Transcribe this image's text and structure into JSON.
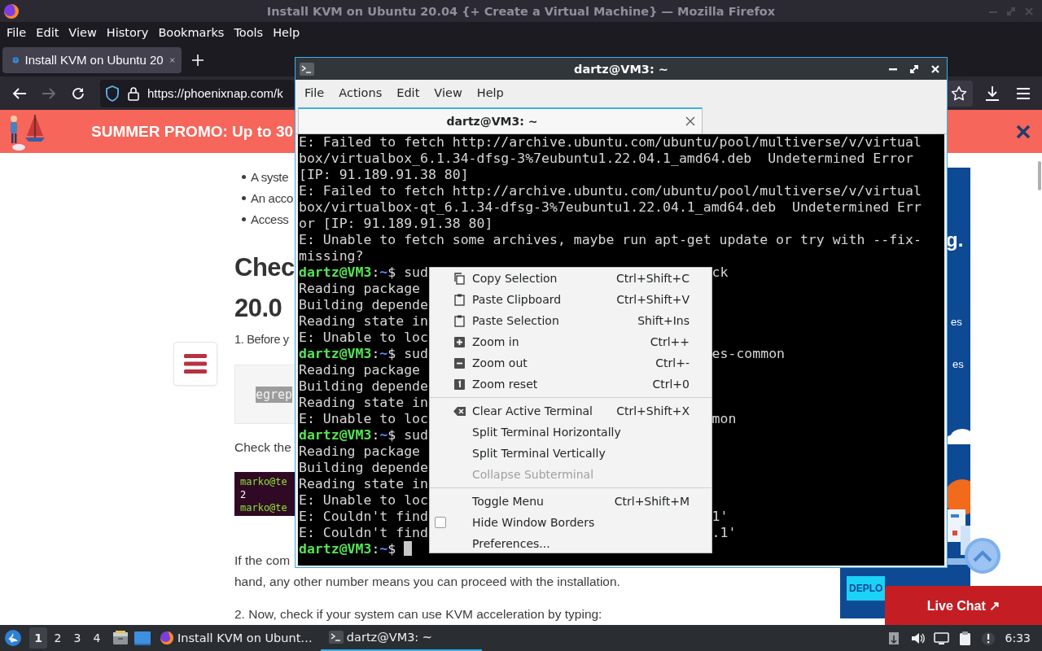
{
  "firefox": {
    "title": "Install KVM on Ubuntu 20.04 {+ Create a Virtual Machine} — Mozilla Firefox",
    "menu": [
      "File",
      "Edit",
      "View",
      "History",
      "Bookmarks",
      "Tools",
      "Help"
    ],
    "tabs": [
      {
        "label": "Install KVM on Ubuntu 20",
        "selected": true
      }
    ],
    "forward_disabled": true,
    "url": "https://phoenixnap.com/k",
    "promo": {
      "text": "SUMMER PROMO: Up to 30"
    },
    "article": {
      "bullets": [
        "A syste",
        "An acco",
        "Access"
      ],
      "heading_lines": [
        "Chec",
        "20.0"
      ],
      "step_1": "1. Before y",
      "code": "egrep",
      "check_text": "Check the",
      "output_lines": [
        {
          "kind": "prompt",
          "text": "marko@te"
        },
        {
          "kind": "output",
          "text": "2"
        },
        {
          "kind": "prompt",
          "text": "marko@te"
        }
      ],
      "paragraph_lines": [
        "If the com",
        "hand, any other number means you can proceed with the installation."
      ],
      "step_2": "2. Now, check if your system can use KVM acceleration by typing:"
    },
    "ad": {
      "fragments": [
        "g.",
        "es",
        "es"
      ],
      "button": "DEPLO"
    },
    "live_chat": "Live Chat ↗"
  },
  "terminal": {
    "title": "dartz@VM3: ~",
    "menu": [
      "File",
      "Actions",
      "Edit",
      "View",
      "Help"
    ],
    "tabs": [
      {
        "label": "dartz@VM3: ~",
        "selected": true
      }
    ],
    "lines": [
      {
        "kind": "output",
        "text": "E: Failed to fetch http://archive.ubuntu.com/ubuntu/pool/multiverse/v/virtual"
      },
      {
        "kind": "output",
        "text": "box/virtualbox_6.1.34-dfsg-3%7eubuntu1.22.04.1_amd64.deb  Undetermined Error"
      },
      {
        "kind": "output",
        "text": "[IP: 91.189.91.38 80]"
      },
      {
        "kind": "output",
        "text": "E: Failed to fetch http://archive.ubuntu.com/ubuntu/pool/multiverse/v/virtual"
      },
      {
        "kind": "output",
        "text": "box/virtualbox-qt_6.1.34-dfsg-3%7eubuntu1.22.04.1_amd64.deb  Undetermined Err"
      },
      {
        "kind": "output",
        "text": "or [IP: 91.189.91.38 80]"
      },
      {
        "kind": "output",
        "text": "E: Unable to fetch some archives, maybe run apt-get update or try with --fix-"
      },
      {
        "kind": "output",
        "text": "missing?"
      },
      {
        "kind": "prompt",
        "user": "dartz@VM3",
        "sep": ":",
        "path": "~",
        "sigil": "$",
        "command": "sud",
        "tail": "ck"
      },
      {
        "kind": "output",
        "text": "Reading package"
      },
      {
        "kind": "output",
        "text": "Building depende"
      },
      {
        "kind": "output",
        "text": "Reading state in"
      },
      {
        "kind": "output",
        "text": "E: Unable to loc"
      },
      {
        "kind": "prompt",
        "user": "dartz@VM3",
        "sep": ":",
        "path": "~",
        "sigil": "$",
        "command": "sud",
        "tail": "es-common"
      },
      {
        "kind": "output",
        "text": "Reading package"
      },
      {
        "kind": "output",
        "text": "Building depende"
      },
      {
        "kind": "output",
        "text": "Reading state in"
      },
      {
        "kind": "output",
        "text": "E: Unable to loc",
        "tail": "mon"
      },
      {
        "kind": "prompt",
        "user": "dartz@VM3",
        "sep": ":",
        "path": "~",
        "sigil": "$",
        "command": "sud"
      },
      {
        "kind": "output",
        "text": "Reading package"
      },
      {
        "kind": "output",
        "text": "Building depende"
      },
      {
        "kind": "output",
        "text": "Reading state in"
      },
      {
        "kind": "output",
        "text": "E: Unable to loc"
      },
      {
        "kind": "output",
        "text": "E: Couldn't find",
        "tail": "1'"
      },
      {
        "kind": "output",
        "text": "E: Couldn't find",
        "tail": ".1'"
      },
      {
        "kind": "prompt",
        "user": "dartz@VM3",
        "sep": ":",
        "path": "~",
        "sigil": "$",
        "cursor": true
      }
    ]
  },
  "context_menu": {
    "items": [
      {
        "kind": "copy",
        "label": "Copy Selection",
        "shortcut": "Ctrl+Shift+C",
        "disabled": false
      },
      {
        "kind": "paste",
        "label": "Paste Clipboard",
        "shortcut": "Ctrl+Shift+V",
        "disabled": false
      },
      {
        "kind": "paste",
        "label": "Paste Selection",
        "shortcut": "Shift+Ins",
        "disabled": false
      },
      {
        "kind": "zoom_in",
        "label": "Zoom in",
        "shortcut": "Ctrl++",
        "disabled": false
      },
      {
        "kind": "zoom_out",
        "label": "Zoom out",
        "shortcut": "Ctrl+-",
        "disabled": false
      },
      {
        "kind": "zoom_reset",
        "label": "Zoom reset",
        "shortcut": "Ctrl+0",
        "disabled": false
      },
      {
        "kind": "separator"
      },
      {
        "kind": "clear",
        "label": "Clear Active Terminal",
        "shortcut": "Ctrl+Shift+X",
        "disabled": false
      },
      {
        "kind": "plain",
        "label": "Split Terminal Horizontally",
        "disabled": false
      },
      {
        "kind": "plain",
        "label": "Split Terminal Vertically",
        "disabled": false
      },
      {
        "kind": "plain",
        "label": "Collapse Subterminal",
        "disabled": true
      },
      {
        "kind": "separator"
      },
      {
        "kind": "plain",
        "label": "Toggle Menu",
        "shortcut": "Ctrl+Shift+M",
        "disabled": false
      },
      {
        "kind": "check",
        "label": "Hide Window Borders",
        "checked": false,
        "disabled": false
      },
      {
        "kind": "plain",
        "label": "Preferences...",
        "disabled": false
      }
    ]
  },
  "taskbar": {
    "workspaces": [
      {
        "label": "1",
        "selected": true
      },
      {
        "label": "2",
        "selected": false
      },
      {
        "label": "3",
        "selected": false
      },
      {
        "label": "4",
        "selected": false
      }
    ],
    "tasks": [
      {
        "kind": "browser",
        "label": "Install KVM on Ubunt…",
        "selected": false
      },
      {
        "kind": "terminal",
        "label": "dartz@VM3: ~",
        "selected": true
      }
    ],
    "clock": "6:33"
  }
}
